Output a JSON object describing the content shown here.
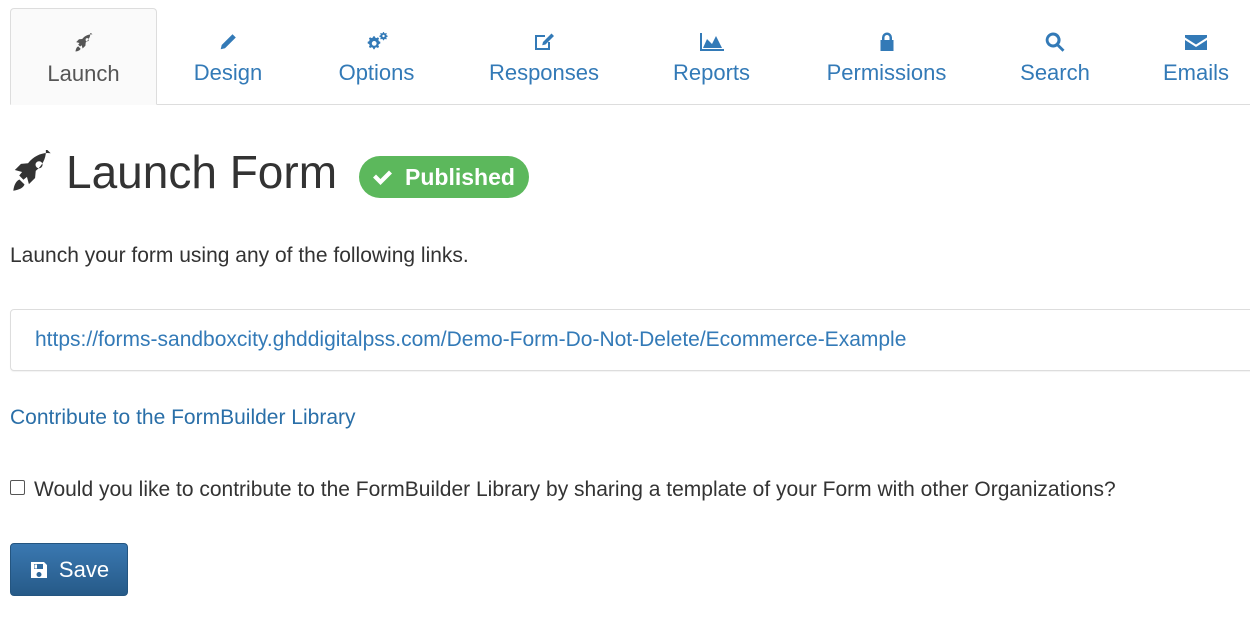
{
  "tabs": [
    {
      "label": "Launch",
      "icon": "rocket-icon",
      "active": true
    },
    {
      "label": "Design",
      "icon": "pencil-icon",
      "active": false
    },
    {
      "label": "Options",
      "icon": "gears-icon",
      "active": false
    },
    {
      "label": "Responses",
      "icon": "edit-icon",
      "active": false
    },
    {
      "label": "Reports",
      "icon": "area-chart-icon",
      "active": false
    },
    {
      "label": "Permissions",
      "icon": "lock-icon",
      "active": false
    },
    {
      "label": "Search",
      "icon": "search-icon",
      "active": false
    },
    {
      "label": "Emails",
      "icon": "envelope-icon",
      "active": false
    }
  ],
  "page": {
    "title": "Launch Form",
    "title_icon": "rocket-icon",
    "status_badge": "Published",
    "status_icon": "check-icon",
    "intro": "Launch your form using any of the following links.",
    "form_url": "https://forms-sandboxcity.ghddigitalpss.com/Demo-Form-Do-Not-Delete/Ecommerce-Example",
    "contribute_link": "Contribute to the FormBuilder Library",
    "contribute_checkbox_label": "Would you like to contribute to the FormBuilder Library by sharing a template of your Form with other Organizations?",
    "contribute_checked": false,
    "save_label": "Save",
    "save_icon": "save-icon"
  },
  "colors": {
    "link": "#337ab7",
    "badge": "#5cb85c",
    "primary_button": "#2e6da4"
  }
}
